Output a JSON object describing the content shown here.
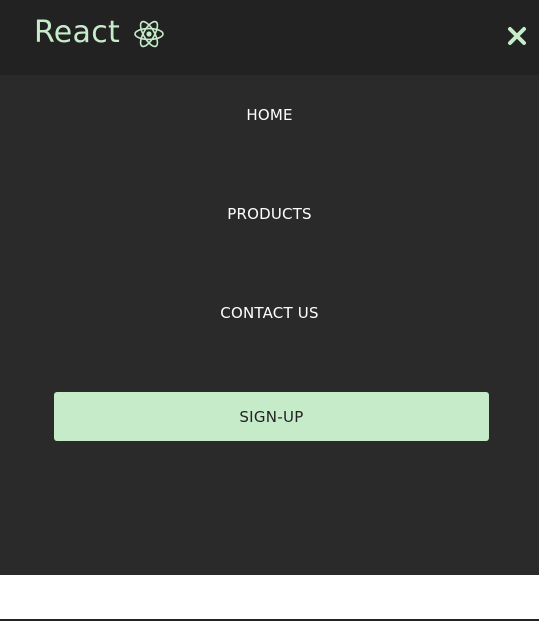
{
  "navbar": {
    "brand_label": "React",
    "brand_icon": "react-atom-icon",
    "close_icon": "close-icon"
  },
  "menu": {
    "items": [
      {
        "label": "HOME"
      },
      {
        "label": "PRODUCTS"
      },
      {
        "label": "CONTACT US"
      }
    ],
    "signup_label": "SIGN-UP"
  },
  "colors": {
    "navbar_bg": "#222222",
    "menu_bg": "#2a2a2a",
    "accent": "#c6ebc9",
    "text": "#ffffff"
  }
}
